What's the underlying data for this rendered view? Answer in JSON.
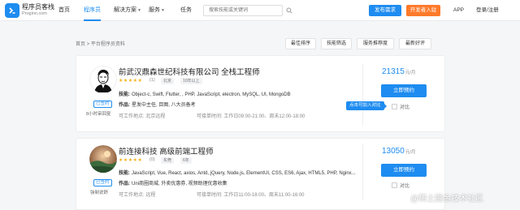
{
  "header": {
    "brand_title": "程序员客栈",
    "brand_domain": "Proginn.com",
    "nav": [
      {
        "label": "首页",
        "caret": false,
        "active": false
      },
      {
        "label": "程序员",
        "caret": false,
        "active": true
      },
      {
        "label": "解决方案",
        "caret": true,
        "active": false
      },
      {
        "label": "服务",
        "caret": true,
        "active": false
      },
      {
        "label": "任务",
        "caret": false,
        "active": false
      }
    ],
    "search_placeholder": "搜索技能或关键词",
    "publish_button": "发布需求",
    "join_button": "开发者入驻",
    "app_link": "APP",
    "login_link": "登录/注册"
  },
  "listing": {
    "breadcrumb": "首页 > 平台程序员资料",
    "sort_options": [
      "最佳排序",
      "技能筛选",
      "服务推荐度",
      "最新好评"
    ]
  },
  "developers": [
    {
      "title": "前武汉鼎森世纪科技有限公司 全栈工程师",
      "stars": "★★★★★",
      "rating_count": "(1)",
      "tags": [
        "北京",
        "10年以上"
      ],
      "skills_label": "技能:",
      "skills": "Object-c, Swift, Flutter, , PHP, JavaScript, electron, MySQL, UI, MongoDB",
      "works_label": "作品:",
      "works": "星发中主任, 目图, 八大员备考",
      "location_label": "可工作地点:",
      "location": "北京远程",
      "time_label": "可接单时间:",
      "time": "工作日09:00-21:00、周末12:00-18:00",
      "price": "21315",
      "price_unit": "元/月",
      "hire_button": "立即预约",
      "compare_label": "对比",
      "tooltip": "点击可加入对比",
      "badge": "已签约",
      "avatar_note": "8小时审回复"
    },
    {
      "title": "前连接科技 高级前端工程师",
      "stars": "★★★★★",
      "rating_count": "(0)",
      "tags": [
        "东莞",
        "6年"
      ],
      "skills_label": "技能:",
      "skills": "JavaScript, Vue, React, axios, Antd, jQuery, Node.js, ElementUI, CSS, ES6, Ajax, HTML5, PHP, Nginx...",
      "works_label": "作品:",
      "works": "Uni商圈商城, 外卖优惠券, 视频助理优惠收集",
      "location_label": "可工作地点:",
      "location": "远程",
      "time_label": "可接单时间:",
      "time": "工作日11:00-18:00、周末11:00-16:00",
      "price": "13050",
      "price_unit": "元/月",
      "hire_button": "立即预约",
      "compare_label": "对比",
      "badge": "已签约",
      "avatar_note": "強制说舒"
    }
  ],
  "watermark": "@稀土掘金技术社区",
  "colors": {
    "primary": "#1e8cf0",
    "orange": "#ff7a2a",
    "star": "#f6b01e"
  }
}
